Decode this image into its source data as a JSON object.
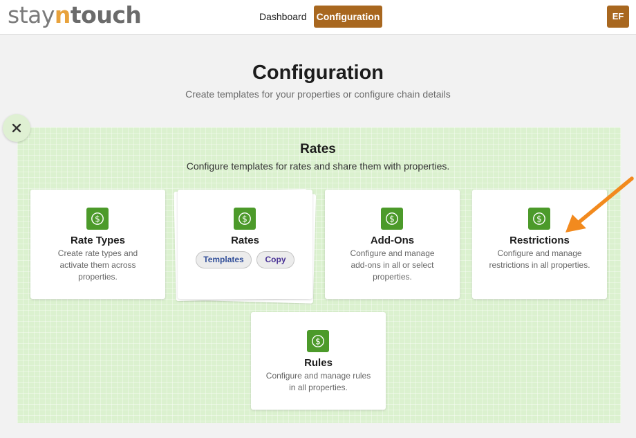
{
  "header": {
    "logo": {
      "part1": "stay",
      "part2": "n",
      "part3": "touch"
    },
    "nav": [
      {
        "label": "Dashboard",
        "active": false
      },
      {
        "label": "Configuration",
        "active": true
      }
    ],
    "user_initials": "EF",
    "accent_color": "#a8671f"
  },
  "page": {
    "title": "Configuration",
    "subtitle": "Create templates for your properties or configure chain details"
  },
  "rates_section": {
    "title": "Rates",
    "subtitle": "Configure templates for rates and share them with properties.",
    "background_color": "#dbf1cf",
    "icon_color": "#4c9a2a",
    "cards": [
      {
        "title": "Rate Types",
        "description": "Create rate types and activate them across properties.",
        "icon": "dollar-icon"
      },
      {
        "title": "Rates",
        "buttons": [
          "Templates",
          "Copy"
        ],
        "icon": "dollar-icon"
      },
      {
        "title": "Add-Ons",
        "description": "Configure and manage add-ons in all or select properties.",
        "icon": "dollar-icon"
      },
      {
        "title": "Restrictions",
        "description": "Configure and manage restrictions in all properties.",
        "icon": "dollar-icon"
      },
      {
        "title": "Rules",
        "description": "Configure and manage rules in all properties.",
        "icon": "dollar-icon"
      }
    ]
  },
  "annotation": {
    "type": "arrow",
    "color": "#f28a1e",
    "points_to": "Restrictions"
  }
}
